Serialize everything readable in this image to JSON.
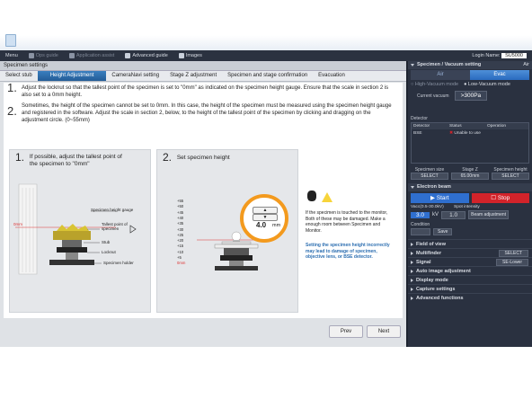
{
  "menubar": {
    "items": [
      {
        "label": "Menu",
        "enabled": true
      },
      {
        "label": "Ops guide",
        "enabled": false
      },
      {
        "label": "Application assist",
        "enabled": false
      },
      {
        "label": "Advanced guide",
        "enabled": true
      },
      {
        "label": "Images",
        "enabled": true
      }
    ],
    "login_label": "Login Name:",
    "login_value": "SU5000"
  },
  "panel_title": "Specimen settings",
  "steps": [
    {
      "label": "Select stub",
      "active": false
    },
    {
      "label": "Height Adjustment",
      "active": true
    },
    {
      "label": "CameraNavi setting",
      "active": false
    },
    {
      "label": "Stage Z adjustment",
      "active": false
    },
    {
      "label": "Specimen and stage confirmation",
      "active": false
    },
    {
      "label": "Evacuation",
      "active": false
    }
  ],
  "instructions": {
    "i1_num": "1.",
    "i1_text": "Adjust the locknut so that the tallest point of the specimen is set to \"0mm\" as indicated on the specimen height gauge.  Ensure that the scale in section 2 is also set to a 0mm height.",
    "i2_num": "2.",
    "i2_text": "Sometimes, the height of the specimen cannot be set to 0mm. In this case, the height of the specimen must be measured using the specimen height gauge and registered in the software. Adjust the scale in section 2, below, to the height of the tallest point of the specimen by clicking and dragging on the adjustment circle.  (0~55mm)"
  },
  "card1": {
    "num": "1.",
    "title": "If possible, adjust the tallest point of the specimen to \"0mm\"",
    "labels": {
      "gauge": "Specimen height gauge",
      "tallest": "Tallest point of specimen",
      "stub": "Stub",
      "locknut": "Locknut",
      "holder": "Specimen holder",
      "zero": "0mm"
    }
  },
  "card2": {
    "num": "2.",
    "title": "Set specimen height",
    "scale_ticks": [
      "+55",
      "+50",
      "+45",
      "+40",
      "+35",
      "+30",
      "+25",
      "+20",
      "+15",
      "+10",
      "+5",
      "0mm"
    ],
    "height_value": "4.0",
    "height_unit": "mm"
  },
  "warning": {
    "text": "If the specimen is touched to the monitor, Both of these may be damaged. Make a enough room between Specimen and Monitor.",
    "blue_text": "Setting the specimen height incorrectly may lead to damage of specimen, objective lens, or BSE detector."
  },
  "nav": {
    "prev": "Prev",
    "next": "Next"
  },
  "right_panel": {
    "header": "Specimen / Vacuum setting",
    "header_tab": "Air",
    "air_btn": "Air",
    "evac_btn": "Evac",
    "mode_high": "High-Vacuum mode",
    "mode_low": "Low-Vacuum mode",
    "current_vacuum_label": "Current vacuum",
    "current_vacuum_value": ">300Pa",
    "detector_label": "Detector",
    "detector_cols": [
      "Detector",
      "Status",
      "Operation"
    ],
    "detector_row": {
      "name": "BSE",
      "status": "Unable to use"
    },
    "specimen_size_label": "Specimen size",
    "specimen_size_value": "SELECT",
    "stage_z_label": "Stage Z",
    "stage_z_value": "65.00mm",
    "specimen_height_label": "Specimen height",
    "specimen_height_value": "SELECT",
    "electron_beam": "Electron beam",
    "start_btn": "Start",
    "stop_btn": "Stop",
    "vacc_label": "Vacc(0.5-30.0kV)",
    "vacc_value": "3.0",
    "vacc_unit": "kV",
    "spot_label": "Spot intensity",
    "spot_value": "1.0",
    "beam_adjustment": "Beam adjustment",
    "condition_label": "Condition",
    "save_label": "Save",
    "collapsed": [
      {
        "label": "Field of view",
        "extra": ""
      },
      {
        "label": "Multifinder",
        "extra": "SELECT"
      },
      {
        "label": "Signal",
        "extra": "SE-Lower"
      },
      {
        "label": "Auto image adjustment",
        "extra": ""
      },
      {
        "label": "Display mode",
        "extra": ""
      },
      {
        "label": "Capture settings",
        "extra": ""
      },
      {
        "label": "Advanced functions",
        "extra": ""
      }
    ]
  },
  "colors": {
    "accent_blue": "#2d6fb1",
    "start_blue": "#2f6fcf",
    "stop_red": "#d2232a",
    "highlight_orange": "#f39a1e",
    "warning_yellow": "#f7d43b"
  }
}
